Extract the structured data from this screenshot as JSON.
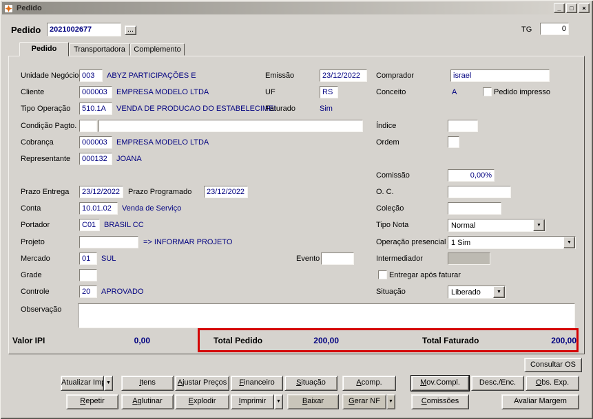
{
  "window": {
    "title": "Pedido",
    "controls": {
      "minimize": "_",
      "maximize": "□",
      "close": "×"
    }
  },
  "colors": {
    "accent_navy": "#000080",
    "highlight_red": "#d40000",
    "window_bg": "#d6d3ce"
  },
  "icons": {
    "dropdown_arrow": "▼",
    "lookup": "...",
    "app_icon": "starburst"
  },
  "header": {
    "pedido_label": "Pedido",
    "pedido_value": "2021002677",
    "tg_label": "TG",
    "tg_value": "0"
  },
  "tabs": [
    {
      "label": "Pedido"
    },
    {
      "label": "Transportadora"
    },
    {
      "label": "Complemento"
    }
  ],
  "form": {
    "unidade_negocio": {
      "label": "Unidade Negócio",
      "code": "003",
      "desc": "ABYZ PARTICIPAÇÕES E"
    },
    "emissao": {
      "label": "Emissão",
      "value": "23/12/2022"
    },
    "comprador": {
      "label": "Comprador",
      "value": "israel"
    },
    "cliente": {
      "label": "Cliente",
      "code": "000003",
      "desc": "EMPRESA MODELO LTDA"
    },
    "uf": {
      "label": "UF",
      "value": "RS"
    },
    "conceito": {
      "label": "Conceito",
      "value": "A"
    },
    "pedido_impresso": {
      "label": "Pedido impresso"
    },
    "tipo_operacao": {
      "label": "Tipo Operação",
      "code": "510.1A",
      "desc": "VENDA DE PRODUCAO DO ESTABELECIMEI"
    },
    "faturado": {
      "label": "Faturado",
      "value": "Sim"
    },
    "condicao_pagto": {
      "label": "Condição Pagto.",
      "code": "",
      "desc": ""
    },
    "indice": {
      "label": "Índice",
      "value": ""
    },
    "cobranca": {
      "label": "Cobrança",
      "code": "000003",
      "desc": "EMPRESA MODELO LTDA"
    },
    "ordem": {
      "label": "Ordem",
      "value": ""
    },
    "representante": {
      "label": "Representante",
      "code": "000132",
      "desc": "JOANA"
    },
    "comissao": {
      "label": "Comissão",
      "value": "0,00%"
    },
    "prazo_entrega": {
      "label": "Prazo Entrega",
      "value": "23/12/2022"
    },
    "prazo_programado": {
      "label": "Prazo Programado",
      "value": "23/12/2022"
    },
    "oc": {
      "label": "O. C.",
      "value": ""
    },
    "conta": {
      "label": "Conta",
      "code": "10.01.02",
      "desc": "Venda de Serviço"
    },
    "colecao": {
      "label": "Coleção",
      "value": ""
    },
    "portador": {
      "label": "Portador",
      "code": "C01",
      "desc": "BRASIL CC"
    },
    "tipo_nota": {
      "label": "Tipo Nota",
      "value": "Normal"
    },
    "projeto": {
      "label": "Projeto",
      "value": "",
      "hint": "=> INFORMAR PROJETO"
    },
    "operacao_presencial": {
      "label": "Operação presencial",
      "value": "1 Sim"
    },
    "mercado": {
      "label": "Mercado",
      "code": "01",
      "desc": "SUL"
    },
    "evento": {
      "label": "Evento",
      "value": ""
    },
    "intermediador": {
      "label": "Intermediador",
      "value": ""
    },
    "grade": {
      "label": "Grade",
      "value": ""
    },
    "entregar_apos_faturar": {
      "label": "Entregar após faturar"
    },
    "controle": {
      "label": "Controle",
      "code": "20",
      "desc": "APROVADO"
    },
    "situacao": {
      "label": "Situação",
      "value": "Liberado"
    },
    "observacao": {
      "label": "Observação",
      "value": ""
    }
  },
  "totals": {
    "valor_ipi_label": "Valor IPI",
    "valor_ipi": "0,00",
    "total_pedido_label": "Total Pedido",
    "total_pedido": "200,00",
    "total_faturado_label": "Total Faturado",
    "total_faturado": "200,00"
  },
  "buttons": {
    "consultar_os": "Consultar OS",
    "row1": [
      "Atualizar Imp",
      "Itens",
      "Ajustar Preços",
      "Financeiro",
      "Situação",
      "Acomp.",
      "Mov.Compl.",
      "Desc./Enc.",
      "Obs. Exp."
    ],
    "row2": [
      "Repetir",
      "Aglutinar",
      "Explodir",
      "Imprimir",
      "Baixar",
      "Gerar NF",
      "Comissões",
      "Avaliar Margem"
    ]
  }
}
